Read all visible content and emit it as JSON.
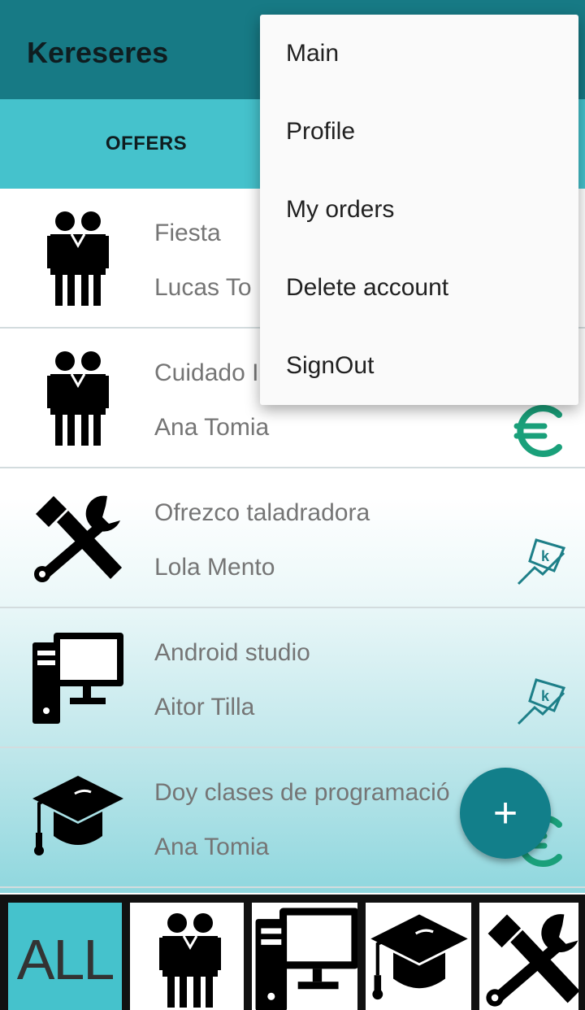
{
  "app": {
    "title": "Kereseres"
  },
  "tabs": [
    {
      "label": "OFFERS"
    },
    {
      "label": ""
    }
  ],
  "list": {
    "items": [
      {
        "title": "Fiesta",
        "subtitle": "Lucas To",
        "icon": "people-icon",
        "badge": "none"
      },
      {
        "title": "Cuidado I",
        "subtitle": "Ana Tomia",
        "icon": "people-icon",
        "badge": "euro-icon"
      },
      {
        "title": "Ofrezco taladradora",
        "subtitle": "Lola Mento",
        "icon": "tools-icon",
        "badge": "trade-icon"
      },
      {
        "title": "Android studio",
        "subtitle": "Aitor Tilla",
        "icon": "computer-icon",
        "badge": "trade-icon"
      },
      {
        "title": "Doy clases de programació",
        "subtitle": "Ana Tomia",
        "icon": "graduation-cap-icon",
        "badge": "euro-icon"
      }
    ]
  },
  "fab": {
    "label": "+"
  },
  "categories": [
    {
      "label": "ALL",
      "icon": "all-text"
    },
    {
      "label": "",
      "icon": "people-icon"
    },
    {
      "label": "",
      "icon": "computer-icon"
    },
    {
      "label": "",
      "icon": "graduation-cap-icon"
    },
    {
      "label": "",
      "icon": "tools-icon"
    }
  ],
  "overflow_menu": {
    "items": [
      {
        "label": "Main"
      },
      {
        "label": "Profile"
      },
      {
        "label": "My orders"
      },
      {
        "label": "Delete account"
      },
      {
        "label": "SignOut"
      }
    ]
  },
  "colors": {
    "appbar": "#177a85",
    "tabs": "#45c2cc",
    "indicator": "#9c27b0",
    "fab": "#127f8a",
    "euro": "#1aa07a",
    "trade": "#1d7f88"
  }
}
